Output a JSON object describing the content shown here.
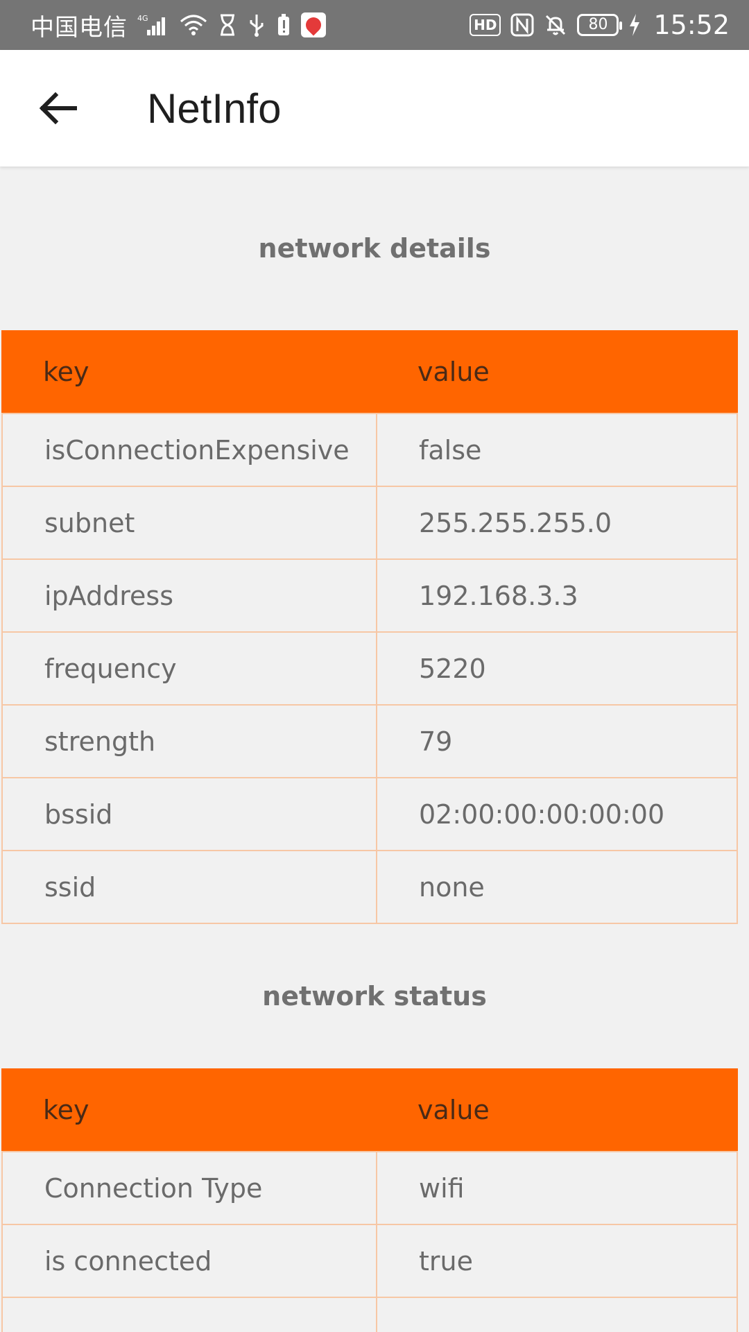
{
  "status_bar": {
    "carrier": "中国电信",
    "network_type": "4G",
    "battery": "80",
    "time": "15:52",
    "hd_badge": "HD",
    "icons": [
      "signal-icon",
      "wifi-icon",
      "hourglass-icon",
      "usb-icon",
      "battery-alert-icon",
      "map-app-icon",
      "hd-icon",
      "nfc-icon",
      "bell-off-icon",
      "battery-icon",
      "charging-icon"
    ]
  },
  "app_bar": {
    "title": "NetInfo",
    "back_icon": "arrow-left-icon"
  },
  "colors": {
    "accent": "#ff6500",
    "border": "#f7c7a5",
    "background": "#f1f1f1",
    "status_bar": "#757575"
  },
  "sections": [
    {
      "title": "network details",
      "header": {
        "key": "key",
        "value": "value"
      },
      "rows": [
        {
          "key": "isConnectionExpensive",
          "value": "false"
        },
        {
          "key": "subnet",
          "value": "255.255.255.0"
        },
        {
          "key": "ipAddress",
          "value": "192.168.3.3"
        },
        {
          "key": "frequency",
          "value": "5220"
        },
        {
          "key": "strength",
          "value": "79"
        },
        {
          "key": "bssid",
          "value": "02:00:00:00:00:00"
        },
        {
          "key": "ssid",
          "value": "none"
        }
      ]
    },
    {
      "title": "network status",
      "header": {
        "key": "key",
        "value": "value"
      },
      "rows": [
        {
          "key": "Connection Type",
          "value": "wifi"
        },
        {
          "key": "is connected",
          "value": "true"
        }
      ]
    }
  ]
}
